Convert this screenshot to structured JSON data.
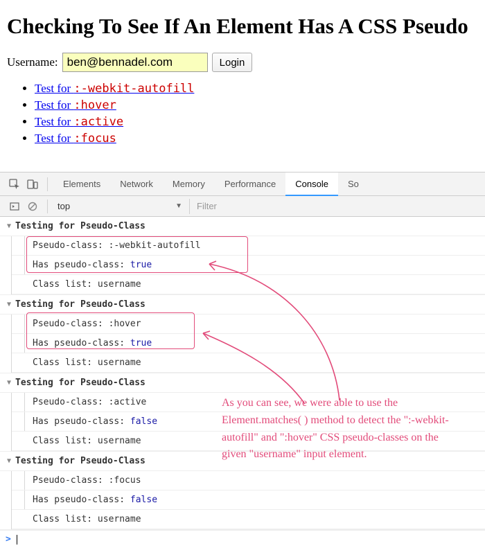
{
  "page": {
    "title": "Checking To See If An Element Has A CSS Pseudo",
    "form": {
      "label": "Username:",
      "username_value": "ben@bennadel.com",
      "login_label": "Login"
    },
    "tests": [
      {
        "prefix": "Test for ",
        "cls": ":-webkit-autofill"
      },
      {
        "prefix": "Test for ",
        "cls": ":hover"
      },
      {
        "prefix": "Test for ",
        "cls": ":active"
      },
      {
        "prefix": "Test for ",
        "cls": ":focus"
      }
    ]
  },
  "devtools": {
    "tabs": [
      "Elements",
      "Network",
      "Memory",
      "Performance",
      "Console",
      "So"
    ],
    "active_tab": "Console",
    "context": "top",
    "filter_placeholder": "Filter",
    "groups": [
      {
        "header": "Testing for Pseudo-Class",
        "highlight": true,
        "lines": [
          {
            "label": "Pseudo-class:",
            "value": ":-webkit-autofill",
            "type": "str"
          },
          {
            "label": "Has pseudo-class:",
            "value": "true",
            "type": "bool"
          },
          {
            "label": "Class list:",
            "value": "username",
            "type": "str"
          }
        ]
      },
      {
        "header": "Testing for Pseudo-Class",
        "highlight": true,
        "lines": [
          {
            "label": "Pseudo-class:",
            "value": ":hover",
            "type": "str"
          },
          {
            "label": "Has pseudo-class:",
            "value": "true",
            "type": "bool"
          },
          {
            "label": "Class list:",
            "value": "username",
            "type": "str"
          }
        ]
      },
      {
        "header": "Testing for Pseudo-Class",
        "highlight": false,
        "lines": [
          {
            "label": "Pseudo-class:",
            "value": ":active",
            "type": "str"
          },
          {
            "label": "Has pseudo-class:",
            "value": "false",
            "type": "bool"
          },
          {
            "label": "Class list:",
            "value": "username",
            "type": "str"
          }
        ]
      },
      {
        "header": "Testing for Pseudo-Class",
        "highlight": false,
        "lines": [
          {
            "label": "Pseudo-class:",
            "value": ":focus",
            "type": "str"
          },
          {
            "label": "Has pseudo-class:",
            "value": "false",
            "type": "bool"
          },
          {
            "label": "Class list:",
            "value": "username",
            "type": "str"
          }
        ]
      }
    ],
    "annotation": "As you can see, we were able to use the Element.matches( ) method to detect the \":-webkit-autofill\" and \":hover\" CSS pseudo-classes on the given \"username\" input element."
  }
}
